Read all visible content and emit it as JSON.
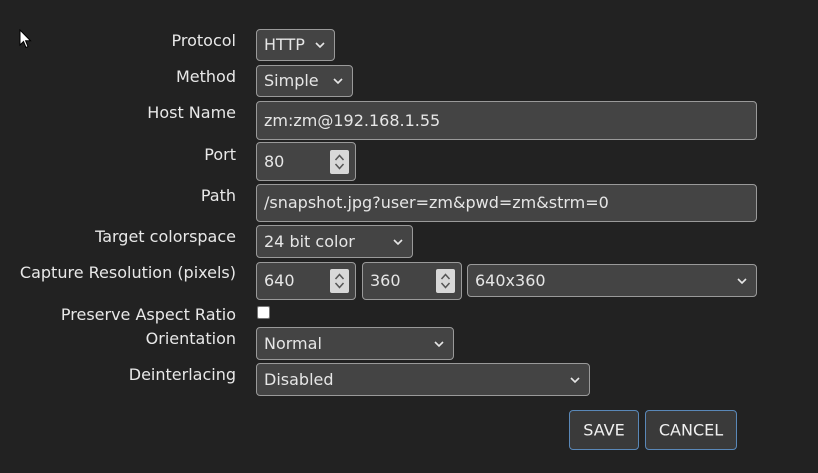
{
  "form": {
    "protocol": {
      "label": "Protocol",
      "value": "HTTP"
    },
    "method": {
      "label": "Method",
      "value": "Simple"
    },
    "host_name": {
      "label": "Host Name",
      "value": "zm:zm@192.168.1.55"
    },
    "port": {
      "label": "Port",
      "value": "80"
    },
    "path": {
      "label": "Path",
      "value": "/snapshot.jpg?user=zm&pwd=zm&strm=0"
    },
    "target_colorspace": {
      "label": "Target colorspace",
      "value": "24 bit color"
    },
    "capture_resolution": {
      "label": "Capture Resolution (pixels)",
      "width": "640",
      "height": "360",
      "preset": "640x360"
    },
    "preserve_aspect_ratio": {
      "label": "Preserve Aspect Ratio",
      "checked": false
    },
    "orientation": {
      "label": "Orientation",
      "value": "Normal"
    },
    "deinterlacing": {
      "label": "Deinterlacing",
      "value": "Disabled"
    }
  },
  "buttons": {
    "save": "SAVE",
    "cancel": "CANCEL"
  },
  "colors": {
    "background": "#222222",
    "control_bg": "#444444",
    "control_border": "#9a9a9a",
    "button_border": "#5a88b8"
  },
  "icons": {
    "dropdown": "chevron-down-icon",
    "stepper": "spinner-arrows-icon",
    "pointer": "mouse-cursor-icon"
  }
}
